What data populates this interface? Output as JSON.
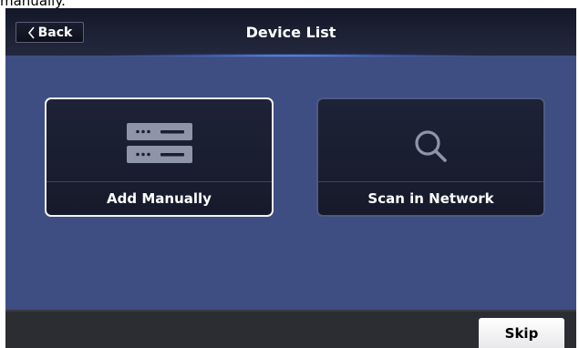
{
  "header": {
    "back_label": "Back",
    "title": "Device List"
  },
  "options": {
    "add_manually": {
      "label": "Add Manually",
      "icon": "server-rack-icon",
      "selected": true
    },
    "scan_network": {
      "label": "Scan in Network",
      "icon": "search-icon",
      "selected": false
    }
  },
  "footer": {
    "skip_label": "Skip"
  },
  "top_strip": {
    "text": "manually."
  },
  "colors": {
    "background": "#3e4d82",
    "titlebar": "#1e2236",
    "card": "#1e2236",
    "accent_glow": "#6eaaff",
    "footer": "#2c2d33"
  }
}
